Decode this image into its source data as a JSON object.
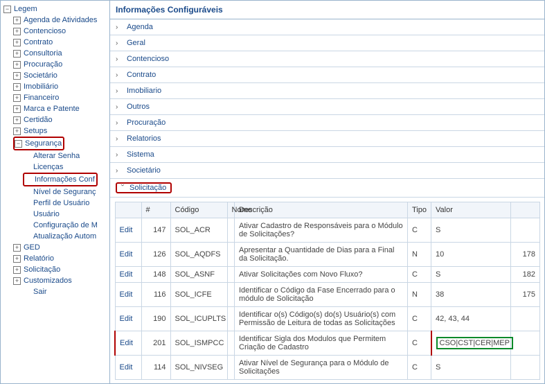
{
  "sidebar": {
    "root": "Legem",
    "items": [
      {
        "label": "Agenda de Atividades",
        "toggle": "+"
      },
      {
        "label": "Contencioso",
        "toggle": "+"
      },
      {
        "label": "Contrato",
        "toggle": "+"
      },
      {
        "label": "Consultoria",
        "toggle": "+"
      },
      {
        "label": "Procuração",
        "toggle": "+"
      },
      {
        "label": "Societário",
        "toggle": "+"
      },
      {
        "label": "Imobiliário",
        "toggle": "+"
      },
      {
        "label": "Financeiro",
        "toggle": "+"
      },
      {
        "label": "Marca e Patente",
        "toggle": "+"
      },
      {
        "label": "Certidão",
        "toggle": "+"
      },
      {
        "label": "Setups",
        "toggle": "+"
      },
      {
        "label": "Segurança",
        "toggle": "−",
        "highlight": true
      },
      {
        "label": "GED",
        "toggle": "+"
      },
      {
        "label": "Relatório",
        "toggle": "+"
      },
      {
        "label": "Solicitação",
        "toggle": "+"
      },
      {
        "label": "Customizados",
        "toggle": "+"
      }
    ],
    "seguranca_children": [
      {
        "label": "Alterar Senha"
      },
      {
        "label": "Licenças"
      },
      {
        "label": "Informações Configuráveis",
        "display": "Informações Conf",
        "highlight": true
      },
      {
        "label": "Nível de Segurança",
        "display": "Nível de Seguranç"
      },
      {
        "label": "Perfil de Usuário"
      },
      {
        "label": "Usuário"
      },
      {
        "label": "Configuração de Módulo",
        "display": "Configuração de M"
      },
      {
        "label": "Atualização Automática",
        "display": "Atualização Autom"
      }
    ],
    "sair": "Sair"
  },
  "main": {
    "title": "Informações Configuráveis",
    "groups": [
      {
        "label": "Agenda",
        "expanded": false
      },
      {
        "label": "Geral",
        "expanded": false
      },
      {
        "label": "Contencioso",
        "expanded": false
      },
      {
        "label": "Contrato",
        "expanded": false
      },
      {
        "label": "Imobiliario",
        "expanded": false
      },
      {
        "label": "Outros",
        "expanded": false
      },
      {
        "label": "Procuração",
        "expanded": false
      },
      {
        "label": "Relatorios",
        "expanded": false
      },
      {
        "label": "Sistema",
        "expanded": false
      },
      {
        "label": "Societário",
        "expanded": false
      },
      {
        "label": "Solicitação",
        "expanded": true,
        "highlight": true
      }
    ],
    "table": {
      "headers": {
        "edit": "",
        "id": "#",
        "code": "Código",
        "name": "Nome",
        "desc": "Descrição",
        "tipo": "Tipo",
        "valor": "Valor",
        "extra": ""
      },
      "edit_label": "Edit",
      "rows": [
        {
          "id": "147",
          "code": "SOL_ACR",
          "desc": "Ativar Cadastro de Responsáveis para o Módulo de Solicitações?",
          "tipo": "C",
          "valor": "S",
          "extra": ""
        },
        {
          "id": "126",
          "code": "SOL_AQDFS",
          "desc": "Apresentar a Quantidade de Dias para a Final da Solicitação.",
          "tipo": "N",
          "valor": "10",
          "extra": "178"
        },
        {
          "id": "148",
          "code": "SOL_ASNF",
          "desc": "Ativar Solicitações com Novo Fluxo?",
          "tipo": "C",
          "valor": "S",
          "extra": "182"
        },
        {
          "id": "116",
          "code": "SOL_ICFE",
          "desc": "Identificar o Código da Fase Encerrado para o módulo de Solicitação",
          "tipo": "N",
          "valor": "38",
          "extra": "175"
        },
        {
          "id": "190",
          "code": "SOL_ICUPLTS",
          "desc": "Identificar o(s) Código(s) do(s) Usuário(s) com Permissão de Leitura de todas as Solicitações",
          "tipo": "C",
          "valor": "42, 43, 44",
          "extra": ""
        },
        {
          "id": "201",
          "code": "SOL_ISMPCC",
          "desc": "Identificar Sigla dos Modulos que Permitem Criação de Cadastro",
          "tipo": "C",
          "valor": "CSO|CST|CER|MEP",
          "extra": "",
          "highlight": true
        },
        {
          "id": "114",
          "code": "SOL_NIVSEG",
          "desc": "Ativar Nível de Segurança para o Módulo de Solicitações",
          "tipo": "C",
          "valor": "S",
          "extra": ""
        }
      ]
    }
  }
}
